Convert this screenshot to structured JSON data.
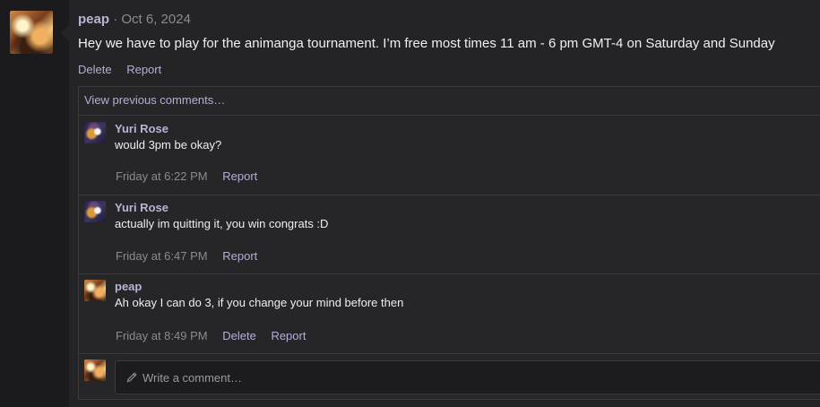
{
  "post": {
    "author": "peap",
    "separator": "·",
    "date": "Oct 6, 2024",
    "body": "Hey we have to play for the animanga tournament. I’m free most times 11 am - 6 pm GMT-4 on Saturday and Sunday",
    "actions": {
      "delete": "Delete",
      "report": "Report"
    },
    "avatar_icon": "user-avatar-peap"
  },
  "thread": {
    "view_previous": "View previous comments…",
    "comments": [
      {
        "author": "Yuri Rose",
        "text": "would 3pm be okay?",
        "time": "Friday at 6:22 PM",
        "report": "Report",
        "avatar_icon": "user-avatar-yuri-rose"
      },
      {
        "author": "Yuri Rose",
        "text": "actually im quitting it, you win congrats :D",
        "time": "Friday at 6:47 PM",
        "report": "Report",
        "avatar_icon": "user-avatar-yuri-rose"
      },
      {
        "author": "peap",
        "text": "Ah okay I can do 3, if you change your mind before then",
        "time": "Friday at 8:49 PM",
        "delete": "Delete",
        "report": "Report",
        "avatar_icon": "user-avatar-peap"
      }
    ],
    "composer": {
      "placeholder": "Write a comment…",
      "icon": "pencil-icon"
    }
  },
  "colors": {
    "link": "#b4aed6",
    "author": "#b9b3d6",
    "muted": "#8b8b8b",
    "background": "#1b1b1d",
    "panel": "#242426"
  }
}
